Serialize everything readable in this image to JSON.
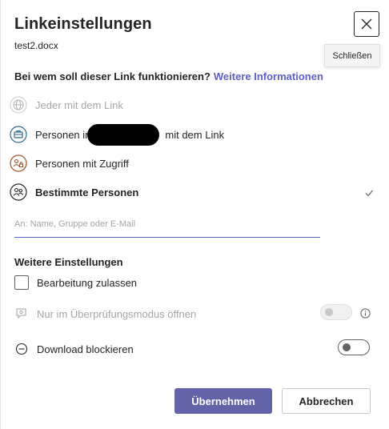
{
  "dialog": {
    "title": "Linkeinstellungen",
    "filename": "test2.docx",
    "close_tooltip": "Schließen"
  },
  "question": {
    "text": "Bei wem soll dieser Link funktionieren?",
    "link": "Weitere Informationen"
  },
  "options": [
    {
      "label": "Jeder mit dem Link",
      "icon": "globe-icon",
      "state": "disabled"
    },
    {
      "label": "Personen in",
      "label_suffix": "mit dem Link",
      "icon": "organization-icon",
      "state": "normal"
    },
    {
      "label": "Personen mit Zugriff",
      "icon": "people-access-icon",
      "state": "normal"
    },
    {
      "label": "Bestimmte Personen",
      "icon": "specific-people-icon",
      "state": "selected"
    }
  ],
  "recipient_input": {
    "placeholder": "An: Name, Gruppe oder E-Mail",
    "value": ""
  },
  "more_settings": {
    "heading": "Weitere Einstellungen",
    "allow_edit": {
      "label": "Bearbeitung zulassen",
      "checked": false
    },
    "review_mode": {
      "label": "Nur im Überprüfungsmodus öffnen",
      "enabled": false,
      "on": false
    },
    "block_download": {
      "label": "Download blockieren",
      "enabled": true,
      "on": false
    }
  },
  "buttons": {
    "apply": "Übernehmen",
    "cancel": "Abbrechen"
  },
  "colors": {
    "accent": "#6264a7",
    "link": "#5b5fc7",
    "disabled_text": "#a6a6a6"
  }
}
